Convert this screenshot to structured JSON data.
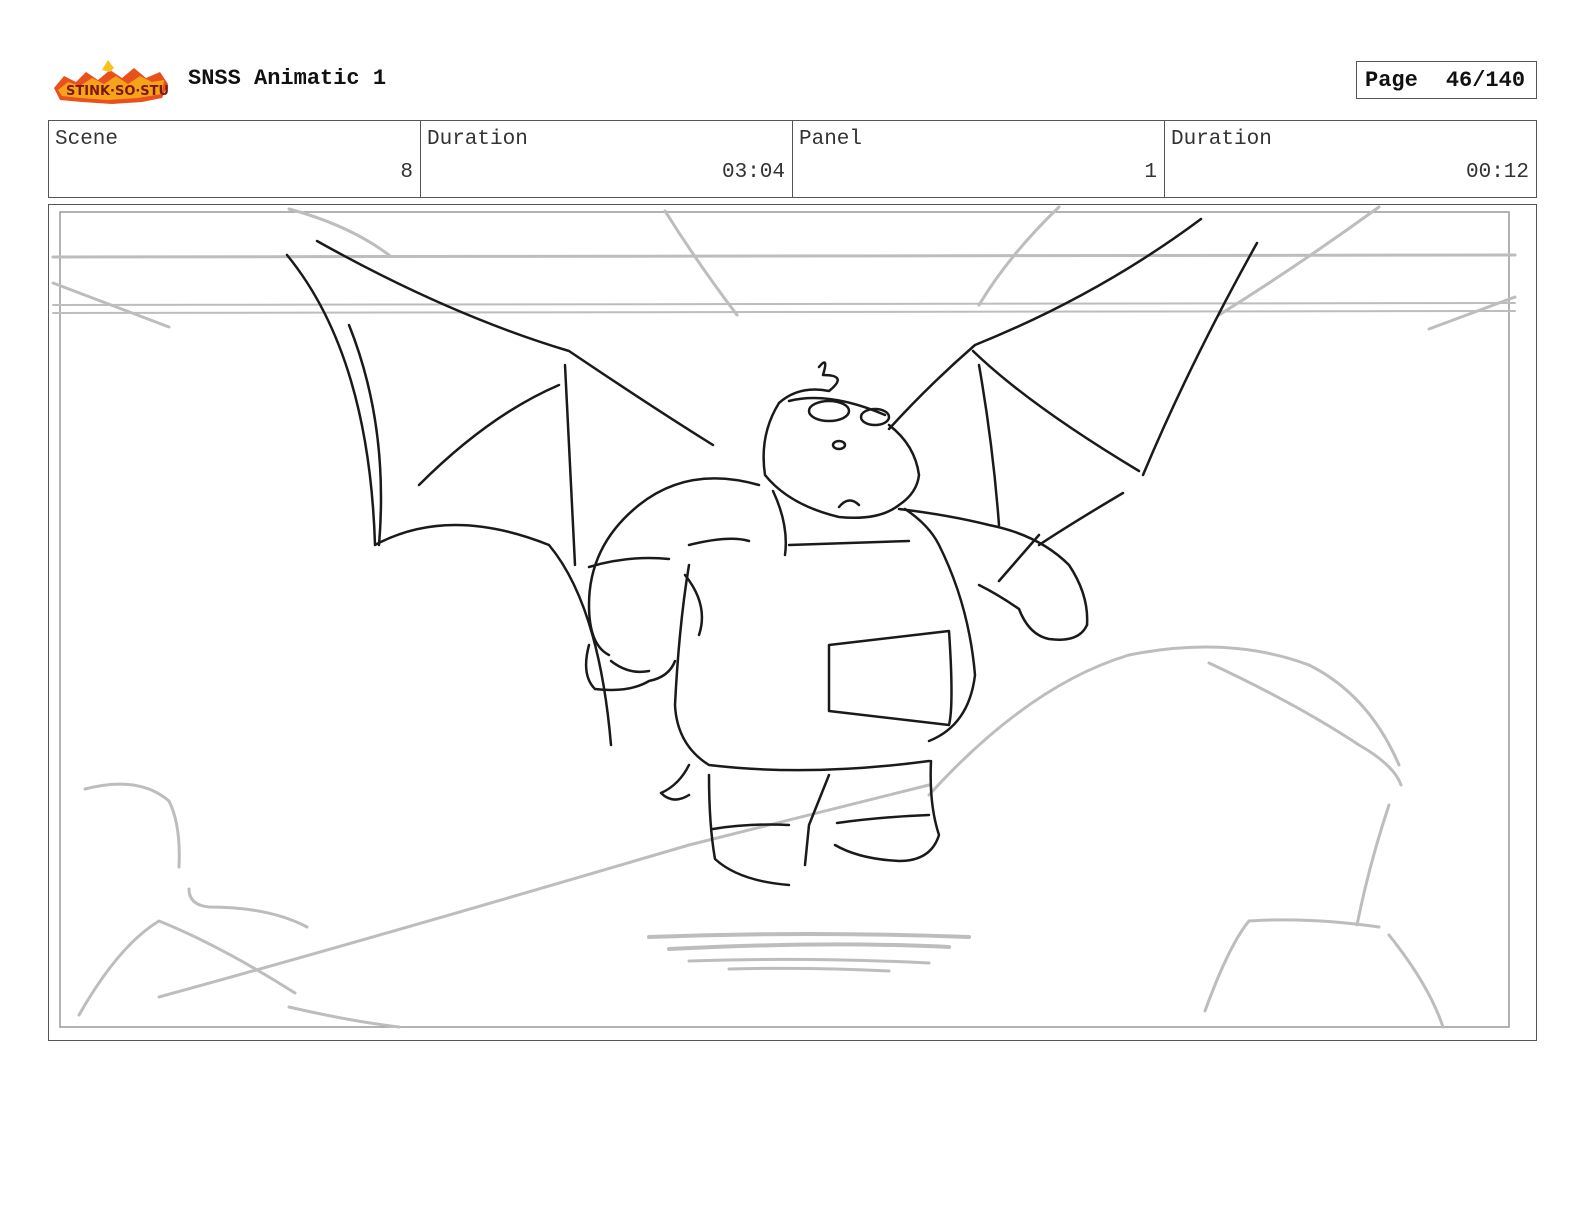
{
  "header": {
    "logo_icon": "show-logo-icon",
    "logo_text": "Sir Stink-So-Stuff",
    "title": "SNSS Animatic 1",
    "page_label": "Page",
    "page_value": "46/140"
  },
  "info": {
    "scene_label": "Scene",
    "scene_value": "8",
    "scene_duration_label": "Duration",
    "scene_duration_value": "03:04",
    "panel_label": "Panel",
    "panel_value": "1",
    "panel_duration_label": "Duration",
    "panel_duration_value": "00:12"
  },
  "panel": {
    "image_icon": "storyboard-sketch-icon"
  }
}
